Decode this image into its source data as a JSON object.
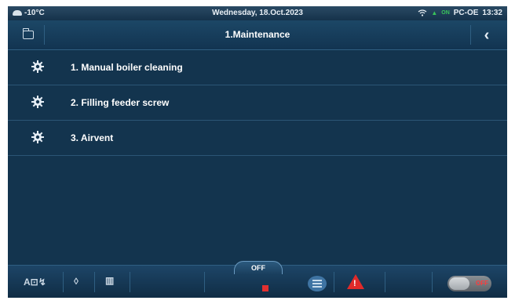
{
  "status_bar": {
    "weather_icon": "cloud-icon",
    "temperature": "-10°C",
    "date": "Wednesday, 18.Oct.2023",
    "wifi_icon": "wifi-icon",
    "mini_on": "ON",
    "device": "PC-OE",
    "time": "13:32"
  },
  "header": {
    "title": "1.Maintenance",
    "back_icon": "‹"
  },
  "menu": {
    "items": [
      {
        "label": "1.  Manual boiler cleaning",
        "icon": "gear-icon"
      },
      {
        "label": "2.  Filling feeder screw",
        "icon": "gear-icon"
      },
      {
        "label": "3.  Airvent",
        "icon": "gear-icon"
      }
    ]
  },
  "bottom_bar": {
    "mode_icon": "A⊡↯",
    "flame_icon": "◊",
    "radiator_icon": "▥",
    "off_tab": "OFF",
    "toggle_label": "OFF",
    "colors": {
      "stop": "#e23030",
      "warning": "#e02a2a"
    }
  }
}
